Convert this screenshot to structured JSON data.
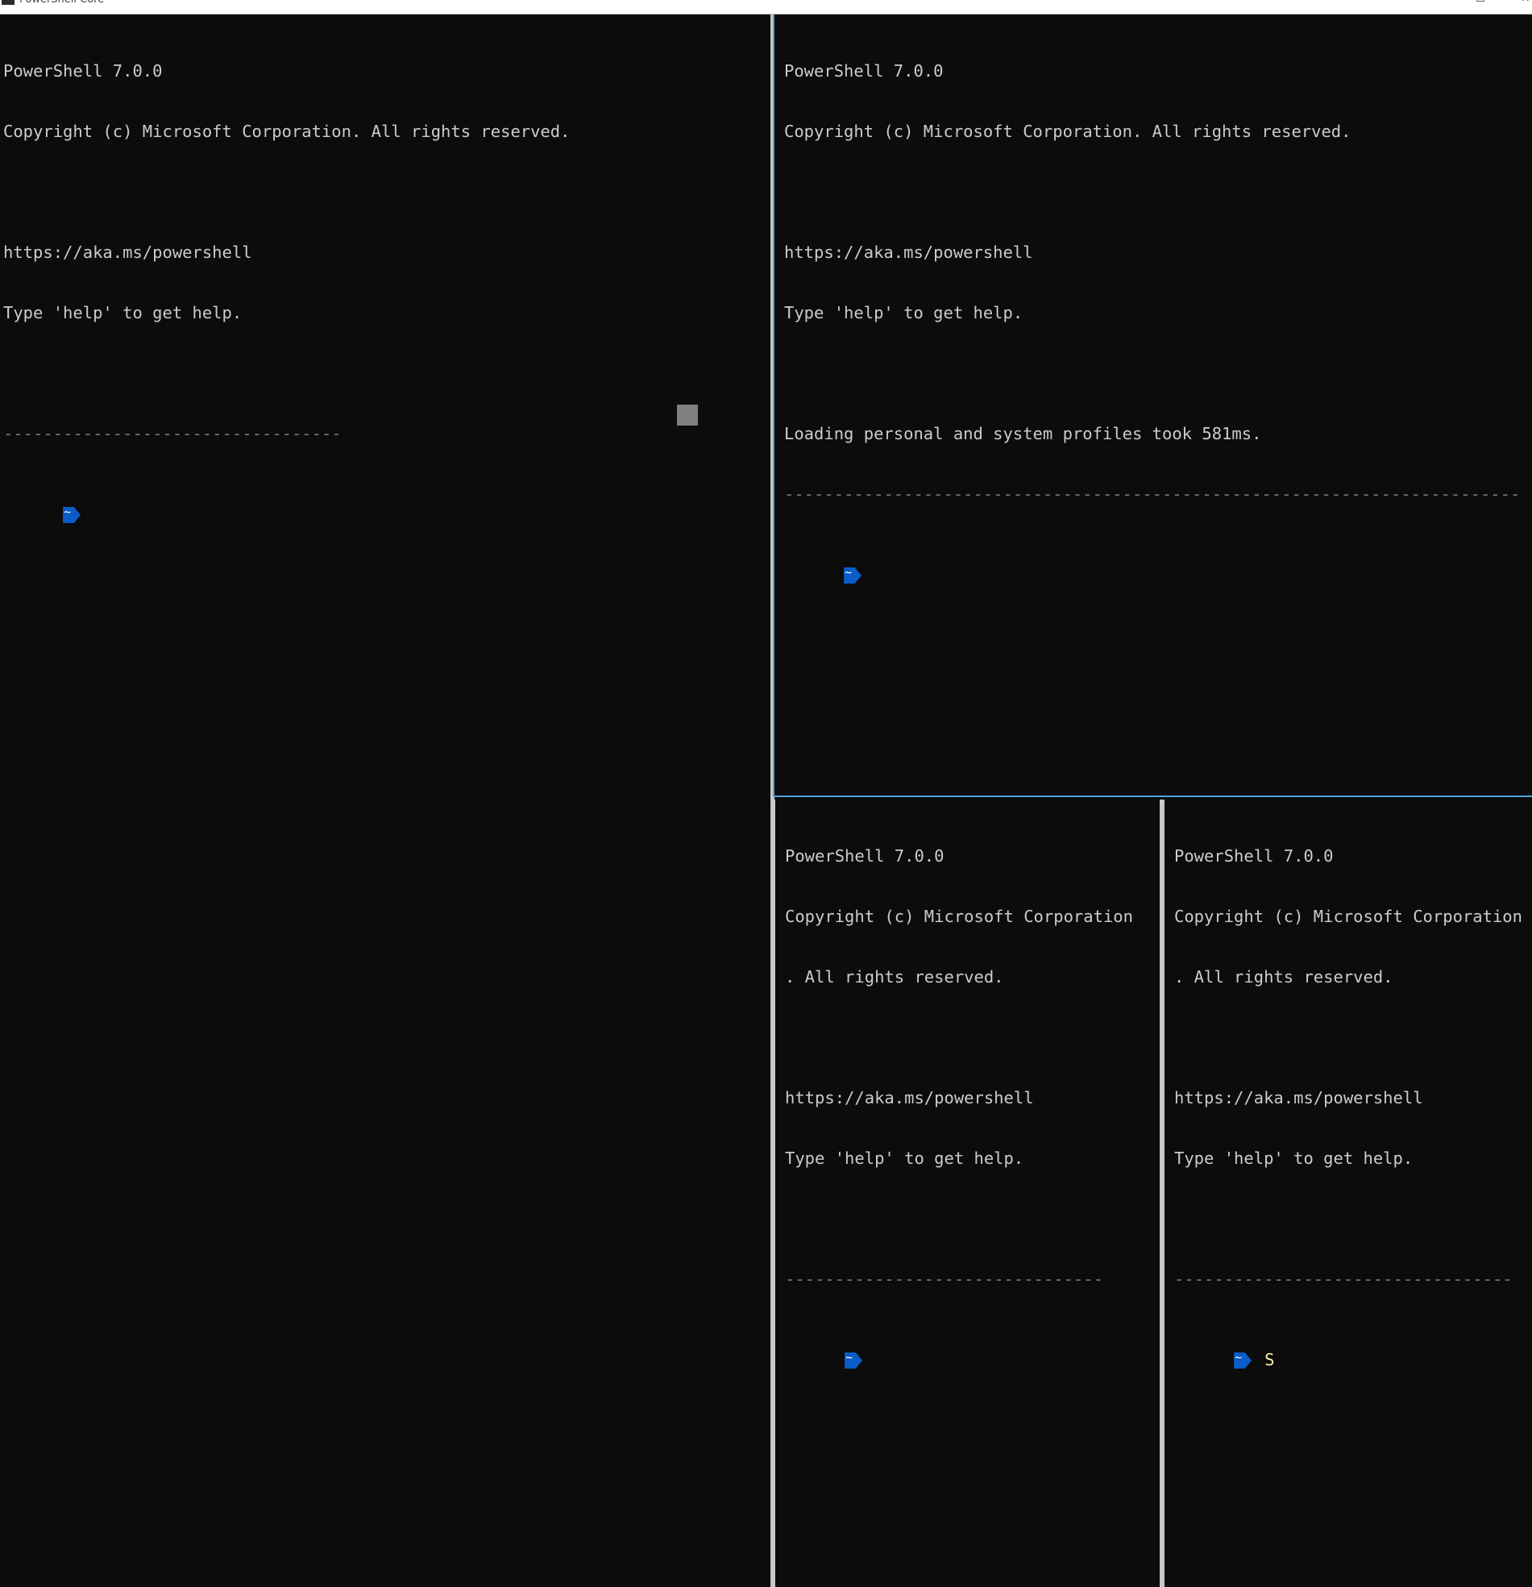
{
  "window": {
    "title": "PowerShell Core",
    "maximize_glyph": "☐",
    "close_glyph": "✕"
  },
  "panes": {
    "left": {
      "lines": [
        "PowerShell 7.0.0",
        "Copyright (c) Microsoft Corporation. All rights reserved.",
        "",
        "https://aka.ms/powershell",
        "Type 'help' to get help.",
        "",
        "----------------------------------"
      ],
      "prompt_path": "~",
      "input": ""
    },
    "top_right": {
      "lines": [
        "PowerShell 7.0.0",
        "Copyright (c) Microsoft Corporation. All rights reserved.",
        "",
        "https://aka.ms/powershell",
        "Type 'help' to get help.",
        "",
        "Loading personal and system profiles took 581ms.",
        "--------------------------------------------------------------------------"
      ],
      "prompt_path": "~",
      "input": ""
    },
    "bottom_left": {
      "lines": [
        "PowerShell 7.0.0",
        "Copyright (c) Microsoft Corporation",
        ". All rights reserved.",
        "",
        "https://aka.ms/powershell",
        "Type 'help' to get help.",
        "",
        "--------------------------------"
      ],
      "prompt_path": "~",
      "input": ""
    },
    "bottom_right": {
      "lines": [
        "PowerShell 7.0.0",
        "Copyright (c) Microsoft Corporation",
        ". All rights reserved.",
        "",
        "https://aka.ms/powershell",
        "Type 'help' to get help.",
        "",
        "----------------------------------"
      ],
      "prompt_path": "~",
      "input": "S"
    }
  },
  "colors": {
    "background": "#0c0c0c",
    "foreground": "#cccccc",
    "prompt": "#0a5cc6",
    "input_text": "#f9f1a5",
    "active_border": "#4fa3dc",
    "inactive_border": "#c8c8c8"
  }
}
